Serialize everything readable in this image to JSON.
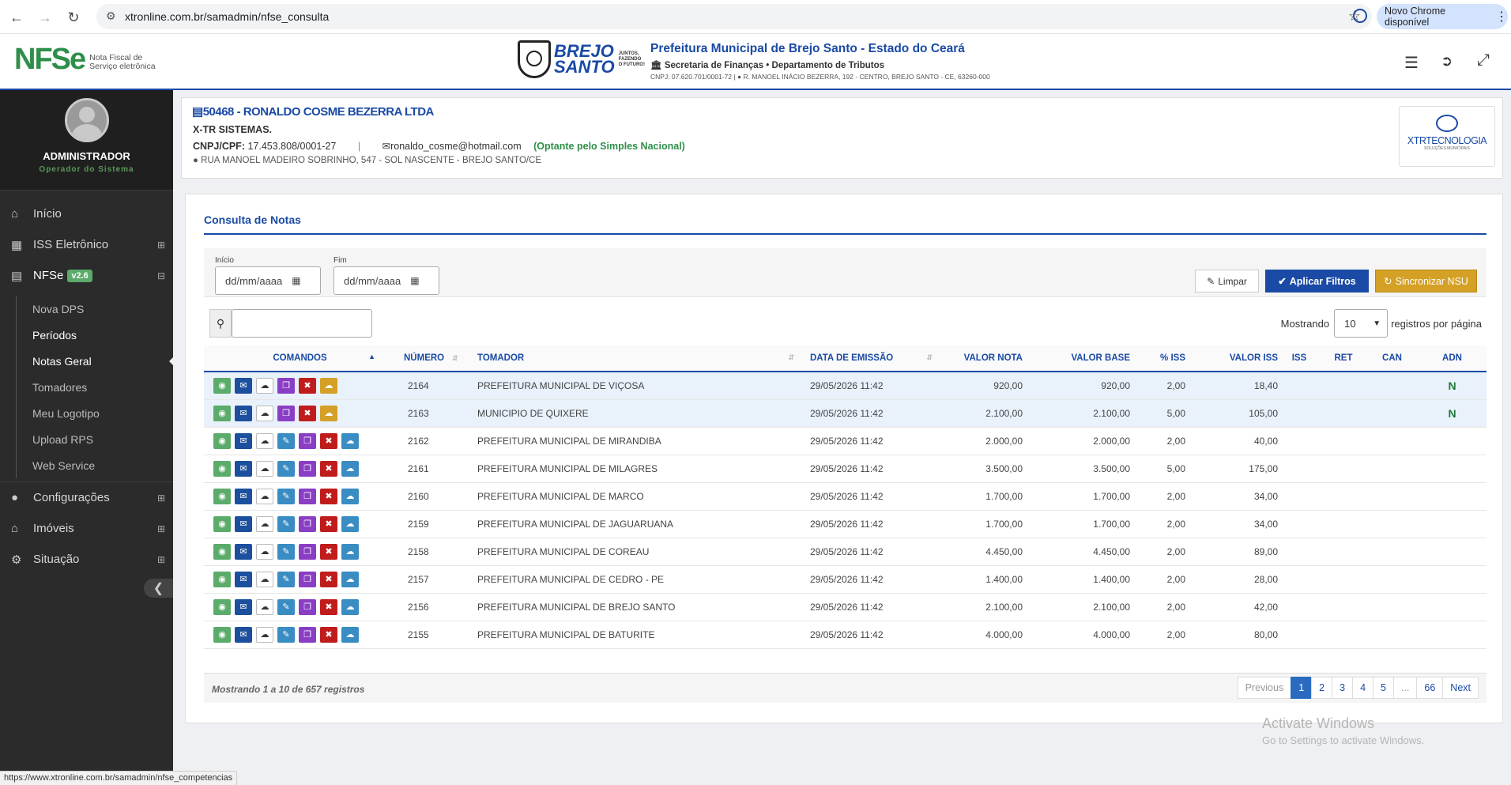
{
  "browser": {
    "url": "xtronline.com.br/samadmin/nfse_consulta",
    "chrome_update": "Novo Chrome disponível"
  },
  "header": {
    "logo_text": "NFSe",
    "logo_sub1": "Nota Fiscal de",
    "logo_sub2": "Serviço eletrônica",
    "brand1": "BREJO",
    "brand2": "SANTO",
    "brand_tag1": "JUNTOS,",
    "brand_tag2": "FAZENDO",
    "brand_tag3": "O FUTURO!",
    "brand_tag4": "PREFEITURA",
    "title": "Prefeitura Municipal de Brejo Santo - Estado do Ceará",
    "subtitle": "Secretaria de Finanças • Departamento de Tributos",
    "info_cnpj": "CNPJ: 07.620.701/0001-72 |",
    "info_addr": "R. MANOEL INÁCIO BEZERRA, 192 - CENTRO, BREJO SANTO - CE, 63260-000"
  },
  "sidebar": {
    "user_name": "ADMINISTRADOR",
    "user_role": "Operador do Sistema",
    "items": [
      {
        "label": "Início"
      },
      {
        "label": "ISS Eletrônico"
      },
      {
        "label": "NFSe",
        "badge": "v2.6"
      }
    ],
    "sub_items": [
      {
        "label": "Nova DPS"
      },
      {
        "label": "Períodos"
      },
      {
        "label": "Notas Geral"
      },
      {
        "label": "Tomadores"
      },
      {
        "label": "Meu Logotipo"
      },
      {
        "label": "Upload RPS"
      },
      {
        "label": "Web Service"
      }
    ],
    "items2": [
      {
        "label": "Configurações"
      },
      {
        "label": "Imóveis"
      },
      {
        "label": "Situação"
      }
    ]
  },
  "company": {
    "title": "50468 - RONALDO COSME BEZERRA LTDA",
    "fantasy": "X-TR SISTEMAS.",
    "cnpj_label": "CNPJ/CPF:",
    "cnpj": "17.453.808/0001-27",
    "email": "ronaldo_cosme@hotmail.com",
    "simples": "(Optante pelo Simples Nacional)",
    "address": "RUA MANOEL MADEIRO SOBRINHO, 547 - SOL NASCENTE - BREJO SANTO/CE",
    "logo_main": "XTRTECNOLOGIA",
    "logo_sub": "SOLUÇÕES MUNICIPAIS"
  },
  "consulta": {
    "title": "Consulta de Notas",
    "inicio_label": "Início",
    "fim_label": "Fim",
    "date_placeholder": "dd/mm/aaaa",
    "btn_limpar": "Limpar",
    "btn_aplicar": "Aplicar Filtros",
    "btn_sincronizar": "Sincronizar NSU",
    "mostrando": "Mostrando",
    "page_size": "10",
    "registros_por_pagina": "registros por página",
    "columns": [
      "COMANDOS",
      "NÚMERO",
      "TOMADOR",
      "DATA DE EMISSÃO",
      "VALOR NOTA",
      "VALOR BASE",
      "% ISS",
      "VALOR ISS",
      "ISS",
      "RET",
      "CAN",
      "ADN"
    ],
    "rows": [
      {
        "numero": "2164",
        "tomador": "PREFEITURA MUNICIPAL DE VIÇOSA",
        "data": "29/05/2026 11:42",
        "valor_nota": "920,00",
        "valor_base": "920,00",
        "pct_iss": "2,00",
        "valor_iss": "18,40",
        "adn": "N",
        "variant": "a"
      },
      {
        "numero": "2163",
        "tomador": "MUNICIPIO DE QUIXERE",
        "data": "29/05/2026 11:42",
        "valor_nota": "2.100,00",
        "valor_base": "2.100,00",
        "pct_iss": "5,00",
        "valor_iss": "105,00",
        "adn": "N",
        "variant": "a"
      },
      {
        "numero": "2162",
        "tomador": "PREFEITURA MUNICIPAL DE MIRANDIBA",
        "data": "29/05/2026 11:42",
        "valor_nota": "2.000,00",
        "valor_base": "2.000,00",
        "pct_iss": "2,00",
        "valor_iss": "40,00",
        "adn": "",
        "variant": "b"
      },
      {
        "numero": "2161",
        "tomador": "PREFEITURA MUNICIPAL DE MILAGRES",
        "data": "29/05/2026 11:42",
        "valor_nota": "3.500,00",
        "valor_base": "3.500,00",
        "pct_iss": "5,00",
        "valor_iss": "175,00",
        "adn": "",
        "variant": "b"
      },
      {
        "numero": "2160",
        "tomador": "PREFEITURA MUNICIPAL DE MARCO",
        "data": "29/05/2026 11:42",
        "valor_nota": "1.700,00",
        "valor_base": "1.700,00",
        "pct_iss": "2,00",
        "valor_iss": "34,00",
        "adn": "",
        "variant": "b"
      },
      {
        "numero": "2159",
        "tomador": "PREFEITURA MUNICIPAL DE JAGUARUANA",
        "data": "29/05/2026 11:42",
        "valor_nota": "1.700,00",
        "valor_base": "1.700,00",
        "pct_iss": "2,00",
        "valor_iss": "34,00",
        "adn": "",
        "variant": "b"
      },
      {
        "numero": "2158",
        "tomador": "PREFEITURA MUNICIPAL DE COREAU",
        "data": "29/05/2026 11:42",
        "valor_nota": "4.450,00",
        "valor_base": "4.450,00",
        "pct_iss": "2,00",
        "valor_iss": "89,00",
        "adn": "",
        "variant": "b"
      },
      {
        "numero": "2157",
        "tomador": "PREFEITURA MUNICIPAL DE CEDRO - PE",
        "data": "29/05/2026 11:42",
        "valor_nota": "1.400,00",
        "valor_base": "1.400,00",
        "pct_iss": "2,00",
        "valor_iss": "28,00",
        "adn": "",
        "variant": "b"
      },
      {
        "numero": "2156",
        "tomador": "PREFEITURA MUNICIPAL DE BREJO SANTO",
        "data": "29/05/2026 11:42",
        "valor_nota": "2.100,00",
        "valor_base": "2.100,00",
        "pct_iss": "2,00",
        "valor_iss": "42,00",
        "adn": "",
        "variant": "b"
      },
      {
        "numero": "2155",
        "tomador": "PREFEITURA MUNICIPAL DE BATURITE",
        "data": "29/05/2026 11:42",
        "valor_nota": "4.000,00",
        "valor_base": "4.000,00",
        "pct_iss": "2,00",
        "valor_iss": "80,00",
        "adn": "",
        "variant": "b"
      }
    ],
    "summary": "Mostrando 1 a 10 de 657 registros",
    "pagination": [
      "Previous",
      "1",
      "2",
      "3",
      "4",
      "5",
      "...",
      "66",
      "Next"
    ]
  },
  "watermark": {
    "line1": "Activate Windows",
    "line2": "Go to Settings to activate Windows."
  },
  "status_url": "https://www.xtronline.com.br/samadmin/nfse_competencias",
  "colors": {
    "primary": "#1a4aa5",
    "sidebar": "#2b2b2b",
    "sync": "#d4a025",
    "green": "#5bab6a"
  }
}
